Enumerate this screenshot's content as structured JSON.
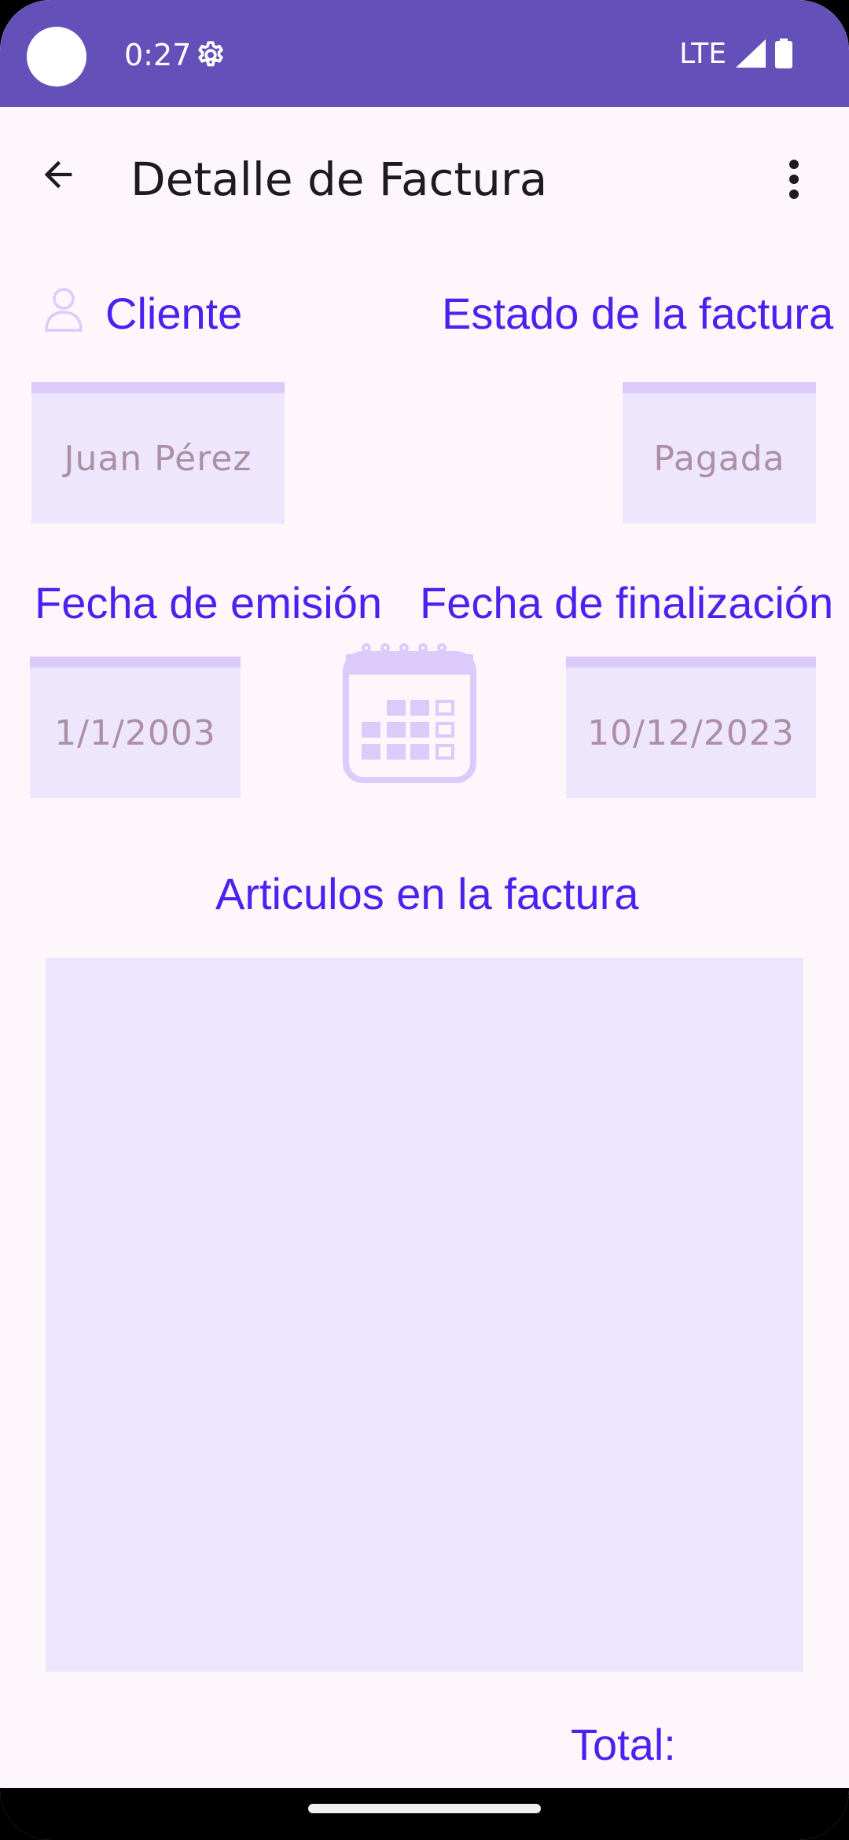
{
  "status_bar": {
    "time": "0:27",
    "network": "LTE",
    "background_color": "#6450b9"
  },
  "app_bar": {
    "title": "Detalle de Factura",
    "back_icon": "arrow-back-icon",
    "menu_icon": "more-vert-icon"
  },
  "client": {
    "label": "Cliente",
    "icon": "person-icon",
    "value": "Juan Pérez"
  },
  "status": {
    "label": "Estado de la factura",
    "value": "Pagada"
  },
  "dates": {
    "issue_label": "Fecha de emisión",
    "issue_value": "1/1/2003",
    "end_label": "Fecha de finalización",
    "end_value": "10/12/2023",
    "calendar_icon": "calendar-icon"
  },
  "items": {
    "title": "Articulos en la factura",
    "list": []
  },
  "total": {
    "label": "Total:"
  },
  "colors": {
    "accent": "#4d20f0",
    "field_bg": "#ede6fd",
    "field_text": "#ad8fa5"
  }
}
